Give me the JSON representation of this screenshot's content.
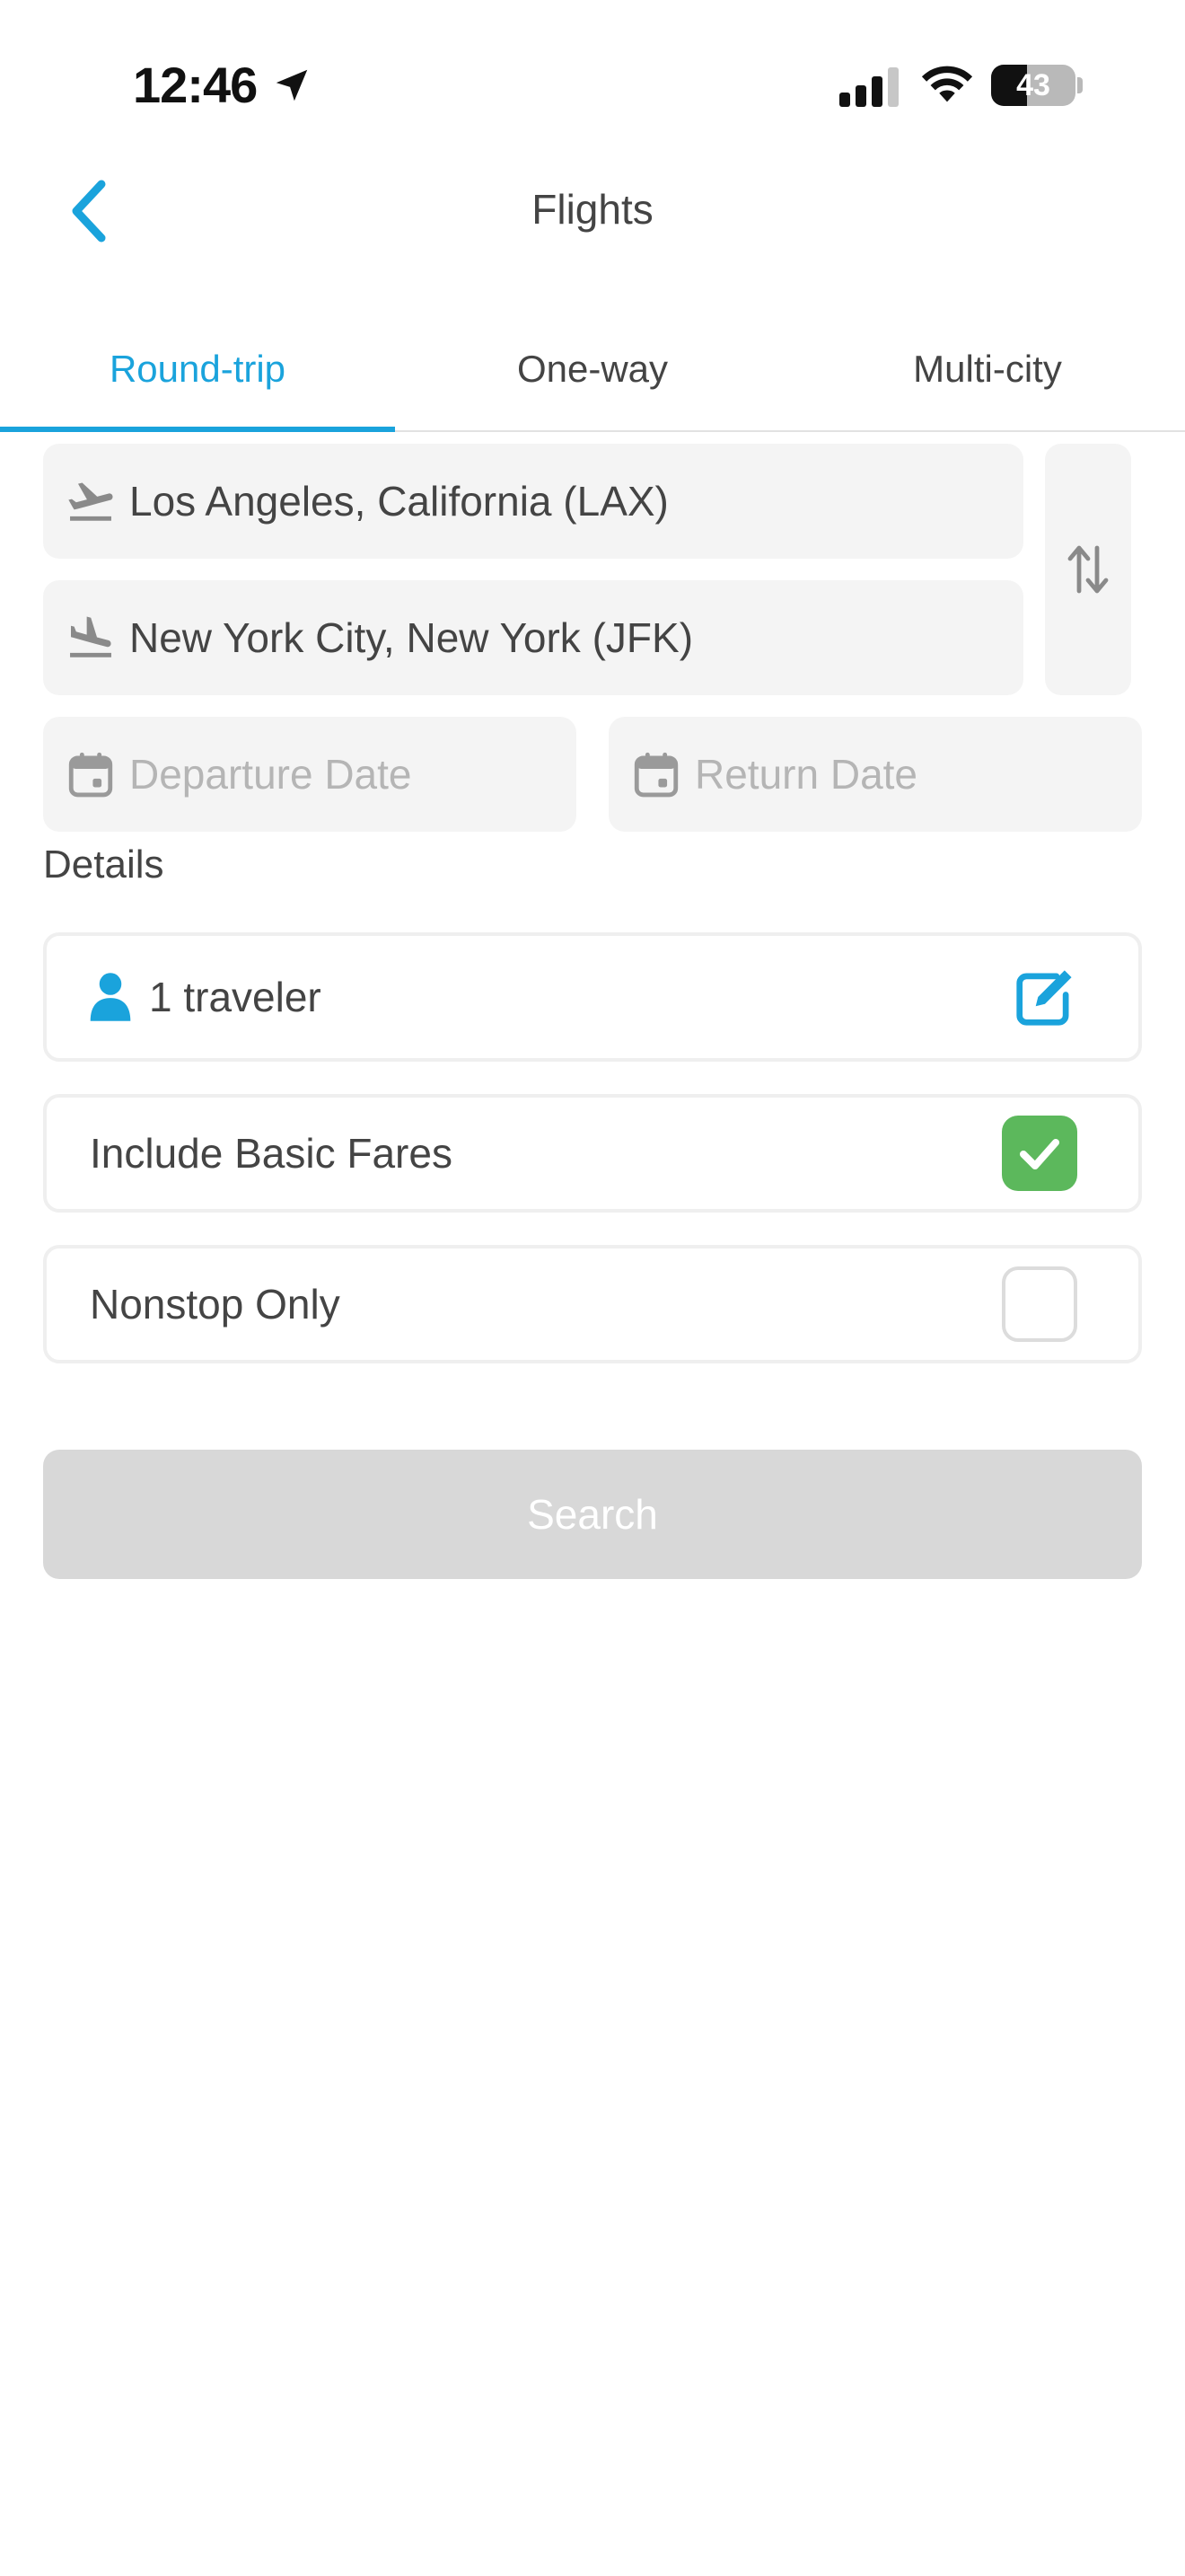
{
  "status_bar": {
    "time": "12:46",
    "battery_level": "43",
    "battery_fraction": 0.43,
    "icons": [
      "location-arrow-icon",
      "cellular-signal-icon",
      "wifi-icon",
      "battery-icon"
    ]
  },
  "header": {
    "title": "Flights",
    "back_icon": "chevron-left-icon"
  },
  "tabs": [
    {
      "label": "Round-trip",
      "active": true
    },
    {
      "label": "One-way",
      "active": false
    },
    {
      "label": "Multi-city",
      "active": false
    }
  ],
  "form": {
    "origin": {
      "value": "Los Angeles, California (LAX)",
      "icon": "plane-takeoff-icon"
    },
    "destination": {
      "value": "New York City, New York (JFK)",
      "icon": "plane-landing-icon"
    },
    "swap_icon": "swap-arrows-icon",
    "departure_date": {
      "placeholder": "Departure Date",
      "icon": "calendar-icon"
    },
    "return_date": {
      "placeholder": "Return Date",
      "icon": "calendar-icon"
    }
  },
  "details": {
    "label": "Details",
    "travelers": {
      "value": "1 traveler",
      "icon": "person-icon",
      "edit_icon": "edit-icon"
    },
    "include_basic_fares": {
      "label": "Include Basic Fares",
      "checked": true
    },
    "nonstop_only": {
      "label": "Nonstop Only",
      "checked": false
    }
  },
  "search_button": {
    "label": "Search",
    "enabled": false
  },
  "colors": {
    "accent": "#1aa3dc",
    "check_green": "#5cb85c",
    "field_bg": "#f4f4f4",
    "disabled_button": "#d8d8d8",
    "text": "#444444",
    "placeholder": "#b5b5b5"
  }
}
